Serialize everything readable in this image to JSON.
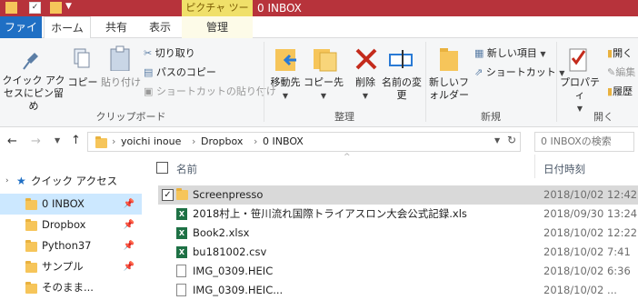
{
  "window": {
    "context_tab": "ピクチャ ツール",
    "title": "0 INBOX"
  },
  "tabs": {
    "file": "ファイル",
    "home": "ホーム",
    "share": "共有",
    "view": "表示",
    "manage": "管理"
  },
  "ribbon": {
    "clipboard": {
      "pin_label": "クイック アクセスにピン留め",
      "copy": "コピー",
      "paste": "貼り付け",
      "cut": "切り取り",
      "copy_path": "パスのコピー",
      "paste_shortcut": "ショートカットの貼り付け",
      "group": "クリップボード"
    },
    "organize": {
      "move_to": "移動先",
      "copy_to": "コピー先",
      "delete": "削除",
      "rename": "名前の変更",
      "group": "整理"
    },
    "new": {
      "new_folder": "新しいフォルダー",
      "new_item": "新しい項目",
      "shortcut": "ショートカット",
      "group": "新規"
    },
    "open": {
      "properties": "プロパティ",
      "open": "開く",
      "edit": "編集",
      "history": "履歴",
      "group": "開く"
    }
  },
  "address": {
    "crumbs": [
      "yoichi inoue",
      "Dropbox",
      "0 INBOX"
    ],
    "search_placeholder": "0 INBOXの検索"
  },
  "nav": {
    "quick_access": "クイック アクセス",
    "items": [
      "0 INBOX",
      "Dropbox",
      "Python37",
      "サンプル",
      "そのまま..."
    ]
  },
  "list": {
    "col_name": "名前",
    "col_date": "日付時刻",
    "rows": [
      {
        "name": "Screenpresso",
        "date": "2018/10/02 12:42",
        "type": "folder"
      },
      {
        "name": "2018村上・笹川流れ国際トライアスロン大会公式記録.xls",
        "date": "2018/09/30 13:24",
        "type": "xls"
      },
      {
        "name": "Book2.xlsx",
        "date": "2018/10/02 12:22",
        "type": "xls"
      },
      {
        "name": "bu181002.csv",
        "date": "2018/10/02 7:41",
        "type": "xls"
      },
      {
        "name": "IMG_0309.HEIC",
        "date": "2018/10/02 6:36",
        "type": "doc"
      },
      {
        "name": "IMG_0309.HEIC...",
        "date": "2018/10/02 ...",
        "type": "doc"
      }
    ]
  },
  "colors": {
    "titlebar": "#b7333b",
    "file_tab": "#1f6fc4",
    "selection": "#cce8ff"
  }
}
